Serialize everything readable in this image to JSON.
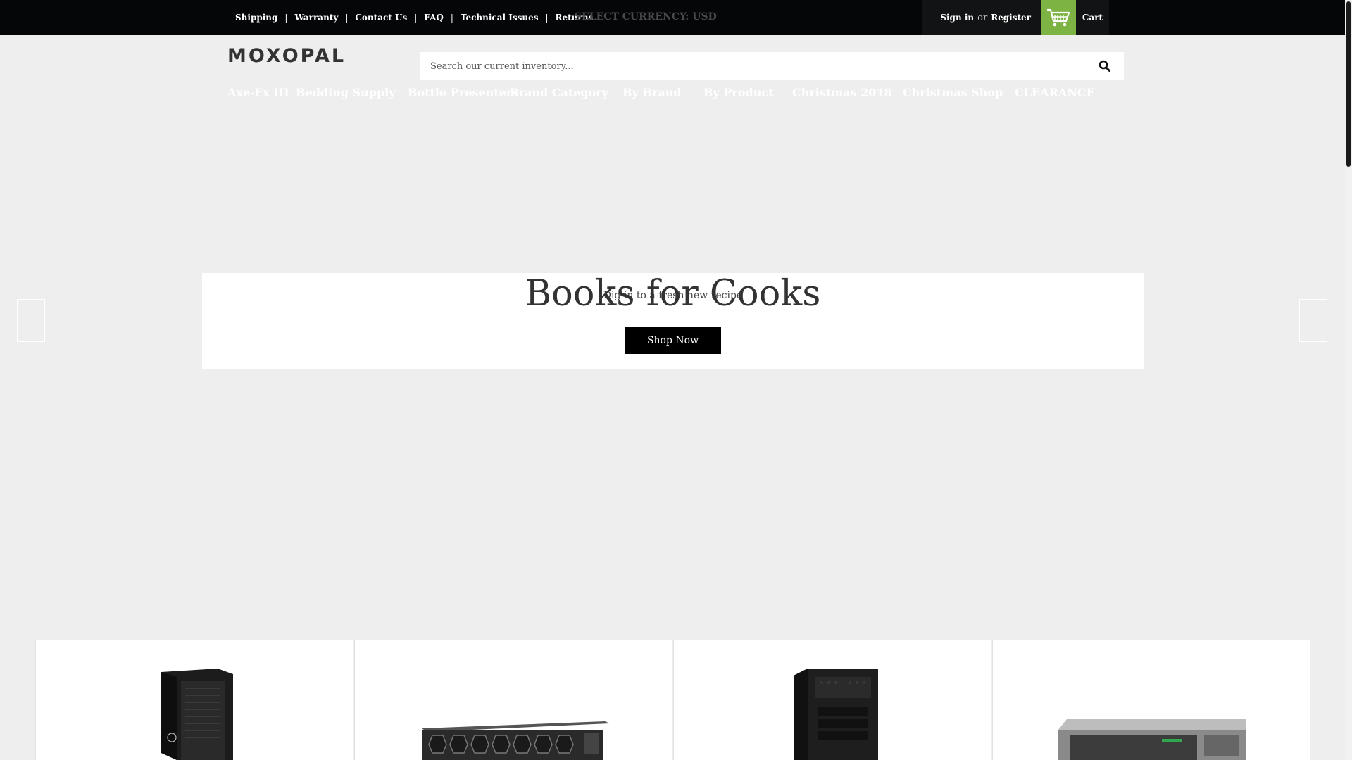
{
  "topbar": {
    "links": [
      "Shipping",
      "Warranty",
      "Contact Us",
      "FAQ",
      "Technical Issues",
      "Returns"
    ],
    "currency_label": "SELECT CURRENCY: USD",
    "sign_in": "Sign in",
    "or": "or",
    "register": "Register",
    "cart": "Cart"
  },
  "header": {
    "logo": "MOXOPAL",
    "search_placeholder": "Search our current inventory..."
  },
  "nav": {
    "items": [
      "Axe-Fx III",
      "Bedding Supply",
      "Bottle Presenters",
      "Brand Category",
      "By Brand",
      "By Product",
      "Christmas 2018",
      "Christmas Shop",
      "CLEARANCE"
    ]
  },
  "hero": {
    "title": "Books for Cooks",
    "subtitle": "Dig in to a fresh new recipe",
    "button": "Shop Now"
  },
  "colors": {
    "topbar_bg": "#050608",
    "cart_accent": "#7cb342",
    "page_bg": "#eeeeee"
  },
  "icons": {
    "cart": "cart-icon",
    "search": "search-icon",
    "prev": "chevron-left-icon",
    "next": "chevron-right-icon"
  }
}
